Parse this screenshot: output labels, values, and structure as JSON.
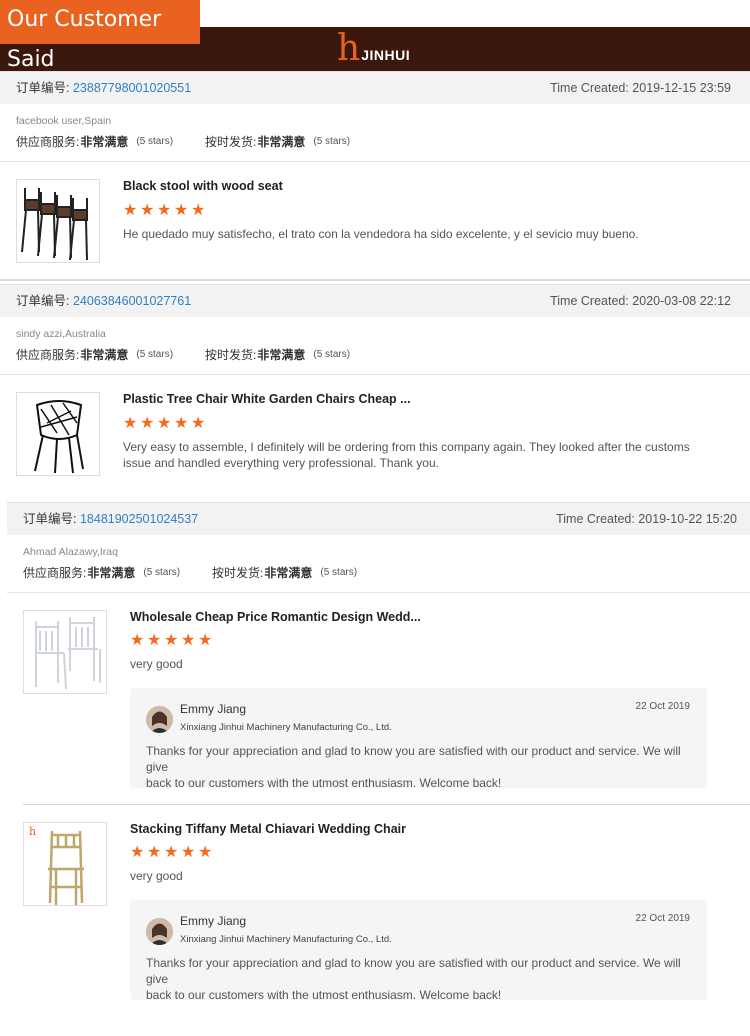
{
  "banner": {
    "title": "Our Customer Said"
  },
  "brand": {
    "logo_letter": "h",
    "name": "JINHUI"
  },
  "orders": [
    {
      "order_label": "订单编号:",
      "order_number": "23887798001020551",
      "time_label": "Time Created: 2019-12-15 23:59",
      "buyer": "facebook user,Spain",
      "service_label": "供应商服务:",
      "service_value": "非常满意",
      "service_stars": "(5 stars)",
      "shipping_label": "按时发货:",
      "shipping_value": "非常满意",
      "shipping_stars": "(5 stars)",
      "items": [
        {
          "title": "Black stool with wood seat",
          "rating": 5,
          "comment": "He quedado muy satisfecho, el trato con la vendedora ha sido excelente, y el sevicio muy bueno."
        }
      ]
    },
    {
      "order_label": "订单编号:",
      "order_number": "24063846001027761",
      "time_label": "Time Created: 2020-03-08 22:12",
      "buyer": "sindy azzi,Australia",
      "service_label": "供应商服务:",
      "service_value": "非常满意",
      "service_stars": "(5 stars)",
      "shipping_label": "按时发货:",
      "shipping_value": "非常满意",
      "shipping_stars": "(5 stars)",
      "items": [
        {
          "title": "Plastic Tree Chair White Garden Chairs Cheap ...",
          "rating": 5,
          "comment_line1": "Very easy to assemble, I definitely will be ordering from this company again. They looked after the customs",
          "comment_line2": "issue and handled everything very professional. Thank you."
        }
      ]
    },
    {
      "order_label": "订单编号:",
      "order_number": "18481902501024537",
      "time_label": "Time Created: 2019-10-22 15:20",
      "buyer": "Ahmad Alazawy,Iraq",
      "service_label": "供应商服务:",
      "service_value": "非常满意",
      "service_stars": "(5 stars)",
      "shipping_label": "按时发货:",
      "shipping_value": "非常满意",
      "shipping_stars": "(5 stars)",
      "items": [
        {
          "title": "Wholesale Cheap Price Romantic Design Wedd...",
          "rating": 5,
          "comment": "very good",
          "reply": {
            "name": "Emmy Jiang",
            "company": "Xinxiang Jinhui Machinery Manufacturing Co., Ltd.",
            "date": "22 Oct 2019",
            "text_line1": "Thanks for your appreciation and glad to know you are satisfied with our product and service. We will give",
            "text_line2": "back to our customers with the utmost enthusiasm. Welcome back!"
          }
        },
        {
          "title": "Stacking Tiffany Metal Chiavari Wedding Chair",
          "rating": 5,
          "comment": "very good",
          "reply": {
            "name": "Emmy Jiang",
            "company": "Xinxiang Jinhui Machinery Manufacturing Co., Ltd.",
            "date": "22 Oct 2019",
            "text_line1": "Thanks for your appreciation and glad to know you are satisfied with our product and service. We will give",
            "text_line2": "back to our customers with the utmost enthusiasm. Welcome back!"
          }
        }
      ]
    }
  ],
  "colors": {
    "accent": "#e9621f",
    "brand_bar": "#3b170d",
    "link": "#2f7fc3",
    "star": "#f46a1e"
  }
}
